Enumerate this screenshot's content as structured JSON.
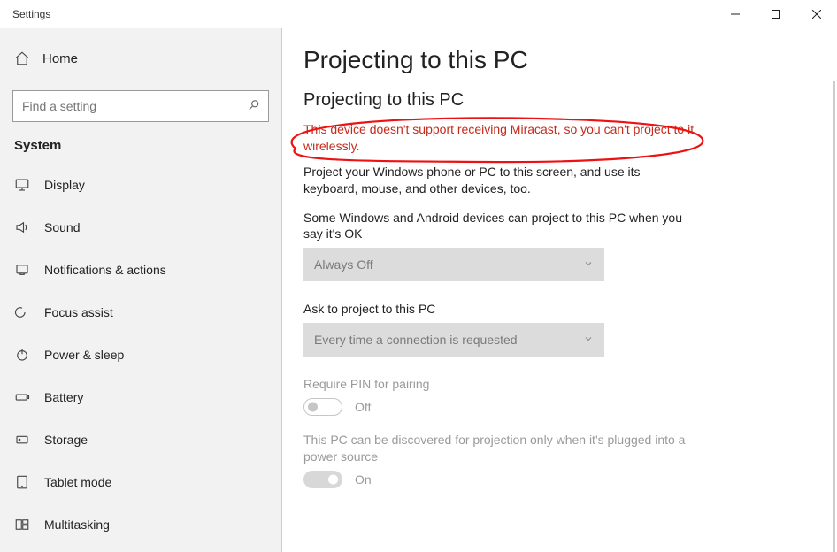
{
  "window": {
    "title": "Settings"
  },
  "sidebar": {
    "home": "Home",
    "search_placeholder": "Find a setting",
    "category": "System",
    "items": [
      {
        "label": "Display",
        "icon": "display-icon"
      },
      {
        "label": "Sound",
        "icon": "sound-icon"
      },
      {
        "label": "Notifications & actions",
        "icon": "notifications-icon"
      },
      {
        "label": "Focus assist",
        "icon": "focus-assist-icon"
      },
      {
        "label": "Power & sleep",
        "icon": "power-icon"
      },
      {
        "label": "Battery",
        "icon": "battery-icon"
      },
      {
        "label": "Storage",
        "icon": "storage-icon"
      },
      {
        "label": "Tablet mode",
        "icon": "tablet-icon"
      },
      {
        "label": "Multitasking",
        "icon": "multitasking-icon"
      }
    ]
  },
  "page": {
    "title": "Projecting to this PC",
    "section": "Projecting to this PC",
    "error": "This device doesn't support receiving Miracast, so you can't project to it wirelessly.",
    "desc": "Project your Windows phone or PC to this screen, and use its keyboard, mouse, and other devices, too.",
    "setting1_label": "Some Windows and Android devices can project to this PC when you say it's OK",
    "setting1_value": "Always Off",
    "setting2_label": "Ask to project to this PC",
    "setting2_value": "Every time a connection is requested",
    "setting3_label": "Require PIN for pairing",
    "setting3_state": "Off",
    "setting4_label": "This PC can be discovered for projection only when it's plugged into a power source",
    "setting4_state": "On"
  }
}
